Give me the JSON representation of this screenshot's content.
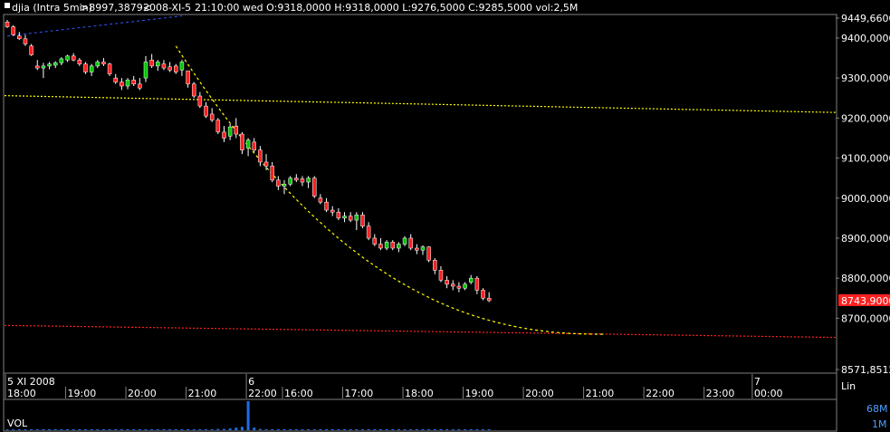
{
  "header": {
    "symbol": "djia (Intra 5min)",
    "cursor_value": ">8997,3879<",
    "date": "2008-XI-5",
    "ohlc": "21:10:00 wed O:9318,0000 H:9318,0000 L:9276,5000 C:9285,5000 vol:2,5M"
  },
  "scale_mode": "Lin",
  "volume_panel": {
    "label": "VOL",
    "max_label": "68M",
    "min_label": "1M"
  },
  "colors": {
    "background": "#000000",
    "up_candle": "#00c800",
    "down_candle": "#ff2020",
    "wick": "#ffffff",
    "price_axis_text": "#ffffff",
    "last_price_bg": "#ff2020",
    "support_line": "#ffff00",
    "resistance_line": "#ff2020",
    "trend_line": "#3355ff",
    "volume": "#1e6ee8"
  },
  "chart_data": {
    "type": "candlestick",
    "ylim": [
      8571.8512,
      9449.66
    ],
    "y_ticks": [
      "9449,6600",
      "9400,0000",
      "9300,0000",
      "9200,0000",
      "9100,0000",
      "9000,0000",
      "8900,0000",
      "8800,0000",
      "8700,0000",
      "8571,8512"
    ],
    "y_tick_values": [
      9449.66,
      9400,
      9300,
      9200,
      9100,
      9000,
      8900,
      8800,
      8700,
      8571.8512
    ],
    "last_price_label": "8743,9000",
    "last_price": 8743.9,
    "x_day_labels": [
      {
        "label": "5 XI 2008",
        "slot": 0
      },
      {
        "label": "6",
        "slot": 40
      },
      {
        "label": "7",
        "slot": 124
      }
    ],
    "x_time_labels": [
      {
        "label": "18:00",
        "slot": 0
      },
      {
        "label": "19:00",
        "slot": 10
      },
      {
        "label": "20:00",
        "slot": 20
      },
      {
        "label": "21:00",
        "slot": 30
      },
      {
        "label": "22:00",
        "slot": 40
      },
      {
        "label": "16:00",
        "slot": 46
      },
      {
        "label": "17:00",
        "slot": 56
      },
      {
        "label": "18:00",
        "slot": 66
      },
      {
        "label": "19:00",
        "slot": 76
      },
      {
        "label": "20:00",
        "slot": 86
      },
      {
        "label": "21:00",
        "slot": 96
      },
      {
        "label": "22:00",
        "slot": 106
      },
      {
        "label": "23:00",
        "slot": 116
      },
      {
        "label": "00:00",
        "slot": 124
      }
    ],
    "total_slots": 138,
    "candles": [
      [
        9440,
        9445,
        9425,
        9428
      ],
      [
        9428,
        9432,
        9405,
        9408
      ],
      [
        9405,
        9415,
        9395,
        9398
      ],
      [
        9398,
        9408,
        9380,
        9385
      ],
      [
        9380,
        9385,
        9355,
        9358
      ],
      [
        9330,
        9345,
        9320,
        9325
      ],
      [
        9325,
        9338,
        9300,
        9330
      ],
      [
        9330,
        9340,
        9322,
        9335
      ],
      [
        9332,
        9342,
        9325,
        9338
      ],
      [
        9338,
        9352,
        9332,
        9348
      ],
      [
        9345,
        9358,
        9340,
        9355
      ],
      [
        9355,
        9362,
        9342,
        9345
      ],
      [
        9345,
        9350,
        9330,
        9335
      ],
      [
        9335,
        9340,
        9310,
        9315
      ],
      [
        9315,
        9335,
        9305,
        9330
      ],
      [
        9330,
        9345,
        9325,
        9340
      ],
      [
        9340,
        9350,
        9330,
        9335
      ],
      [
        9335,
        9338,
        9305,
        9310
      ],
      [
        9300,
        9310,
        9285,
        9290
      ],
      [
        9290,
        9300,
        9270,
        9280
      ],
      [
        9280,
        9300,
        9272,
        9295
      ],
      [
        9295,
        9305,
        9280,
        9285
      ],
      [
        9285,
        9300,
        9270,
        9275
      ],
      [
        9300,
        9355,
        9290,
        9340
      ],
      [
        9345,
        9360,
        9325,
        9330
      ],
      [
        9330,
        9345,
        9318,
        9340
      ],
      [
        9335,
        9345,
        9320,
        9325
      ],
      [
        9328,
        9340,
        9315,
        9320
      ],
      [
        9330,
        9335,
        9310,
        9315
      ],
      [
        9320,
        9345,
        9305,
        9340
      ],
      [
        9318,
        9318,
        9276,
        9285
      ],
      [
        9285,
        9290,
        9250,
        9255
      ],
      [
        9255,
        9265,
        9225,
        9230
      ],
      [
        9230,
        9240,
        9200,
        9205
      ],
      [
        9210,
        9225,
        9190,
        9195
      ],
      [
        9195,
        9200,
        9160,
        9165
      ],
      [
        9165,
        9180,
        9140,
        9150
      ],
      [
        9155,
        9185,
        9145,
        9178
      ],
      [
        9180,
        9200,
        9150,
        9160
      ],
      [
        9160,
        9165,
        9110,
        9120
      ],
      [
        9125,
        9150,
        9105,
        9145
      ],
      [
        9140,
        9150,
        9115,
        9120
      ],
      [
        9120,
        9130,
        9080,
        9090
      ],
      [
        9090,
        9110,
        9070,
        9080
      ],
      [
        9080,
        9090,
        9040,
        9045
      ],
      [
        9045,
        9055,
        9020,
        9030
      ],
      [
        9030,
        9045,
        9010,
        9035
      ],
      [
        9035,
        9055,
        9030,
        9050
      ],
      [
        9050,
        9060,
        9040,
        9045
      ],
      [
        9048,
        9055,
        9030,
        9040
      ],
      [
        9040,
        9055,
        9025,
        9050
      ],
      [
        9050,
        9055,
        9000,
        9005
      ],
      [
        9000,
        9010,
        8985,
        8990
      ],
      [
        8990,
        9000,
        8965,
        8970
      ],
      [
        8970,
        8980,
        8955,
        8965
      ],
      [
        8965,
        8975,
        8945,
        8950
      ],
      [
        8950,
        8965,
        8940,
        8955
      ],
      [
        8955,
        8965,
        8940,
        8945
      ],
      [
        8945,
        8965,
        8920,
        8958
      ],
      [
        8958,
        8965,
        8925,
        8930
      ],
      [
        8930,
        8940,
        8895,
        8900
      ],
      [
        8900,
        8910,
        8880,
        8885
      ],
      [
        8885,
        8900,
        8870,
        8875
      ],
      [
        8875,
        8895,
        8870,
        8890
      ],
      [
        8890,
        8895,
        8870,
        8875
      ],
      [
        8875,
        8890,
        8865,
        8885
      ],
      [
        8885,
        8905,
        8880,
        8900
      ],
      [
        8900,
        8910,
        8870,
        8875
      ],
      [
        8875,
        8885,
        8860,
        8870
      ],
      [
        8870,
        8882,
        8858,
        8878
      ],
      [
        8878,
        8880,
        8840,
        8845
      ],
      [
        8845,
        8850,
        8810,
        8820
      ],
      [
        8820,
        8830,
        8790,
        8795
      ],
      [
        8795,
        8805,
        8775,
        8785
      ],
      [
        8785,
        8795,
        8770,
        8780
      ],
      [
        8780,
        8790,
        8765,
        8775
      ],
      [
        8775,
        8790,
        8770,
        8785
      ],
      [
        8790,
        8808,
        8785,
        8800
      ],
      [
        8800,
        8805,
        8760,
        8770
      ],
      [
        8770,
        8775,
        8745,
        8750
      ],
      [
        8750,
        8765,
        8740,
        8744
      ]
    ],
    "volumes": [
      1,
      1,
      1,
      1,
      1,
      1,
      1,
      1,
      1,
      1,
      1,
      1,
      1,
      1,
      1,
      1,
      1,
      1,
      1,
      1,
      1,
      1,
      1,
      1,
      1,
      1,
      1,
      1,
      1,
      1,
      2,
      2,
      2,
      2,
      2,
      3,
      3,
      4,
      6,
      8,
      68,
      6,
      3,
      2,
      2,
      2,
      2,
      2,
      2,
      2,
      2,
      2,
      2,
      2,
      2,
      2,
      2,
      2,
      2,
      2,
      2,
      2,
      2,
      2,
      2,
      2,
      2,
      2,
      2,
      2,
      2,
      2,
      2,
      2,
      2,
      2,
      2,
      2,
      2,
      2,
      2
    ]
  }
}
